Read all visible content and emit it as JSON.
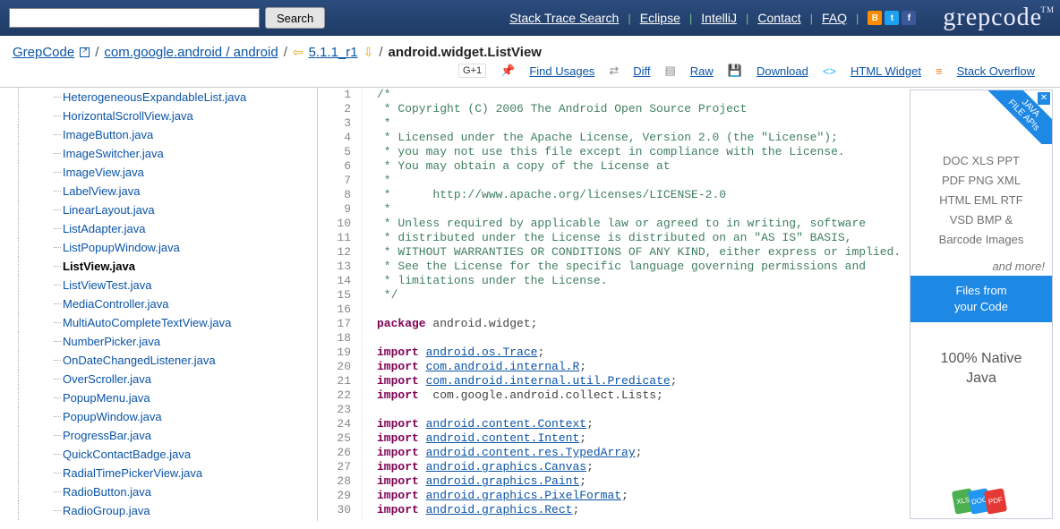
{
  "header": {
    "search_button": "Search",
    "links": [
      "Stack Trace Search",
      "Eclipse",
      "IntelliJ",
      "Contact",
      "FAQ"
    ],
    "logo": "grepcode",
    "logo_tm": "TM"
  },
  "breadcrumb": {
    "root": "GrepCode",
    "pkg": "com.google.android / android",
    "ver": "5.1.1_r1",
    "curr": "android.widget.ListView"
  },
  "actions": {
    "gplus": "G+1",
    "find": "Find Usages",
    "diff": "Diff",
    "raw": "Raw",
    "download": "Download",
    "html": "HTML Widget",
    "so": "Stack Overflow"
  },
  "tree": [
    "HeterogeneousExpandableList.java",
    "HorizontalScrollView.java",
    "ImageButton.java",
    "ImageSwitcher.java",
    "ImageView.java",
    "LabelView.java",
    "LinearLayout.java",
    "ListAdapter.java",
    "ListPopupWindow.java",
    "ListView.java",
    "ListViewTest.java",
    "MediaController.java",
    "MultiAutoCompleteTextView.java",
    "NumberPicker.java",
    "OnDateChangedListener.java",
    "OverScroller.java",
    "PopupMenu.java",
    "PopupWindow.java",
    "ProgressBar.java",
    "QuickContactBadge.java",
    "RadialTimePickerView.java",
    "RadioButton.java",
    "RadioGroup.java"
  ],
  "tree_active": 9,
  "code": [
    {
      "n": 1,
      "cls": "cmt",
      "t": "/*"
    },
    {
      "n": 2,
      "cls": "cmt",
      "t": " * Copyright (C) 2006 The Android Open Source Project"
    },
    {
      "n": 3,
      "cls": "cmt",
      "t": " *"
    },
    {
      "n": 4,
      "cls": "cmt",
      "t": " * Licensed under the Apache License, Version 2.0 (the \"License\");"
    },
    {
      "n": 5,
      "cls": "cmt",
      "t": " * you may not use this file except in compliance with the License."
    },
    {
      "n": 6,
      "cls": "cmt",
      "t": " * You may obtain a copy of the License at"
    },
    {
      "n": 7,
      "cls": "cmt",
      "t": " *"
    },
    {
      "n": 8,
      "cls": "cmt",
      "t": " *      http://www.apache.org/licenses/LICENSE-2.0"
    },
    {
      "n": 9,
      "cls": "cmt",
      "t": " *"
    },
    {
      "n": 10,
      "cls": "cmt",
      "t": " * Unless required by applicable law or agreed to in writing, software"
    },
    {
      "n": 11,
      "cls": "cmt",
      "t": " * distributed under the License is distributed on an \"AS IS\" BASIS,"
    },
    {
      "n": 12,
      "cls": "cmt",
      "t": " * WITHOUT WARRANTIES OR CONDITIONS OF ANY KIND, either express or implied."
    },
    {
      "n": 13,
      "cls": "cmt",
      "t": " * See the License for the specific language governing permissions and"
    },
    {
      "n": 14,
      "cls": "cmt",
      "t": " * limitations under the License."
    },
    {
      "n": 15,
      "cls": "cmt",
      "t": " */"
    },
    {
      "n": 16,
      "cls": "",
      "t": ""
    },
    {
      "n": 17,
      "cls": "",
      "t": "",
      "kw": "package",
      "rest": " android.widget;"
    },
    {
      "n": 18,
      "cls": "",
      "t": ""
    },
    {
      "n": 19,
      "cls": "",
      "kw": "import",
      "link": "android.os.Trace",
      "tail": ";"
    },
    {
      "n": 20,
      "cls": "",
      "kw": "import",
      "link": "com.android.internal.R",
      "tail": ";"
    },
    {
      "n": 21,
      "cls": "",
      "kw": "import",
      "link": "com.android.internal.util.Predicate",
      "tail": ";"
    },
    {
      "n": 22,
      "cls": "",
      "kw": "import",
      "plain": "  com.google.android.collect.Lists;",
      "tail": ""
    },
    {
      "n": 23,
      "cls": "",
      "t": ""
    },
    {
      "n": 24,
      "cls": "",
      "kw": "import",
      "link": "android.content.Context",
      "tail": ";"
    },
    {
      "n": 25,
      "cls": "",
      "kw": "import",
      "link": "android.content.Intent",
      "tail": ";"
    },
    {
      "n": 26,
      "cls": "",
      "kw": "import",
      "link": "android.content.res.TypedArray",
      "tail": ";"
    },
    {
      "n": 27,
      "cls": "",
      "kw": "import",
      "link": "android.graphics.Canvas",
      "tail": ";"
    },
    {
      "n": 28,
      "cls": "",
      "kw": "import",
      "link": "android.graphics.Paint",
      "tail": ";"
    },
    {
      "n": 29,
      "cls": "",
      "kw": "import",
      "link": "android.graphics.PixelFormat",
      "tail": ";"
    },
    {
      "n": 30,
      "cls": "",
      "kw": "import",
      "link": "android.graphics.Rect",
      "tail": ";"
    }
  ],
  "ad": {
    "ribbon1": "JAVA",
    "ribbon2": "FILE APIs",
    "formats": [
      "DOC  XLS  PPT",
      "PDF  PNG  XML",
      "HTML  EML  RTF",
      "VSD  BMP &",
      "Barcode Images"
    ],
    "more": "and more!",
    "blue1": "Files from",
    "blue2": "your Code",
    "native1": "100% Native",
    "native2": "Java"
  }
}
